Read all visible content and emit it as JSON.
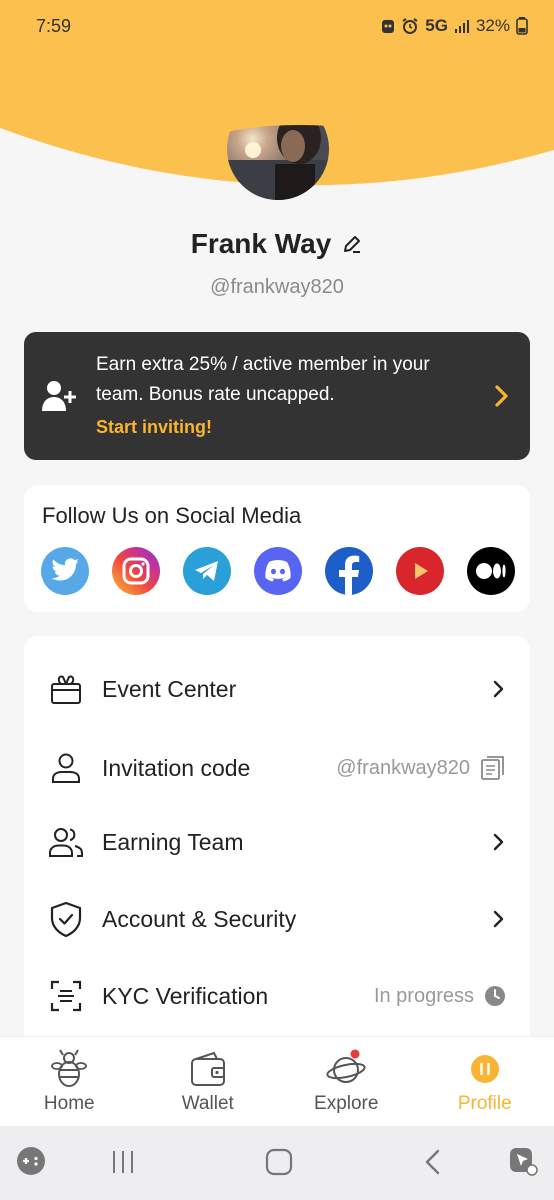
{
  "status_bar": {
    "time": "7:59",
    "network": "5G",
    "battery": "32%"
  },
  "colors": {
    "accent": "#f8b432",
    "banner_bg": "#333333",
    "page_bg": "#f6f6f7"
  },
  "profile": {
    "name": "Frank Way",
    "handle": "@frankway820"
  },
  "invite_banner": {
    "line1": "Earn extra 25% / active member in your",
    "line2": "team. Bonus rate uncapped.",
    "cta": "Start inviting!"
  },
  "social": {
    "title": "Follow Us on Social Media",
    "icons": [
      "twitter-icon",
      "instagram-icon",
      "telegram-icon",
      "discord-icon",
      "facebook-icon",
      "youtube-icon",
      "medium-icon"
    ]
  },
  "menu": {
    "items": [
      {
        "label": "Event Center",
        "icon": "gift-box-icon"
      },
      {
        "label": "Invitation code",
        "icon": "user-icon",
        "value": "@frankway820"
      },
      {
        "label": "Earning Team",
        "icon": "users-icon"
      },
      {
        "label": "Account & Security",
        "icon": "shield-check-icon"
      },
      {
        "label": "KYC Verification",
        "icon": "scan-icon",
        "value": "In progress"
      }
    ]
  },
  "bottom_nav": {
    "items": [
      {
        "label": "Home",
        "icon": "bee-icon"
      },
      {
        "label": "Wallet",
        "icon": "wallet-icon"
      },
      {
        "label": "Explore",
        "icon": "planet-icon"
      },
      {
        "label": "Profile",
        "icon": "profile-icon",
        "active": true
      }
    ]
  }
}
